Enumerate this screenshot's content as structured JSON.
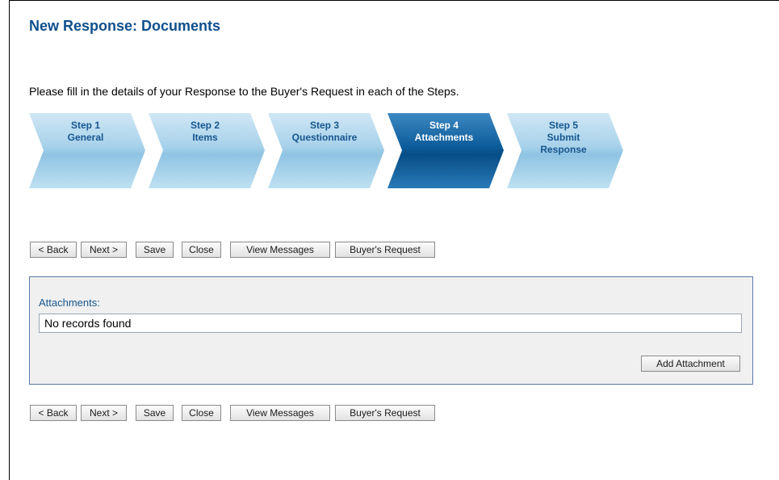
{
  "page": {
    "title": "New Response: Documents",
    "intro": "Please fill in the details of your Response to the Buyer's Request in each of the Steps."
  },
  "steps": [
    {
      "line1": "Step 1",
      "line2": "General",
      "line3": "",
      "active": false
    },
    {
      "line1": "Step 2",
      "line2": "Items",
      "line3": "",
      "active": false
    },
    {
      "line1": "Step 3",
      "line2": "Questionnaire",
      "line3": "",
      "active": false
    },
    {
      "line1": "Step 4",
      "line2": "Attachments",
      "line3": "",
      "active": true
    },
    {
      "line1": "Step 5",
      "line2": "Submit",
      "line3": "Response",
      "active": false
    }
  ],
  "toolbar": {
    "back": "< Back",
    "next": "Next >",
    "save": "Save",
    "close": "Close",
    "view_messages": "View Messages",
    "buyers_request": "Buyer's Request"
  },
  "attachments": {
    "label": "Attachments:",
    "empty_text": "No records found",
    "add_button": "Add Attachment"
  },
  "colors": {
    "title": "#0f4f8c",
    "step_inactive": "#a9d2ea",
    "step_active": "#0d5c9a",
    "panel_border": "#5a7aa8"
  }
}
